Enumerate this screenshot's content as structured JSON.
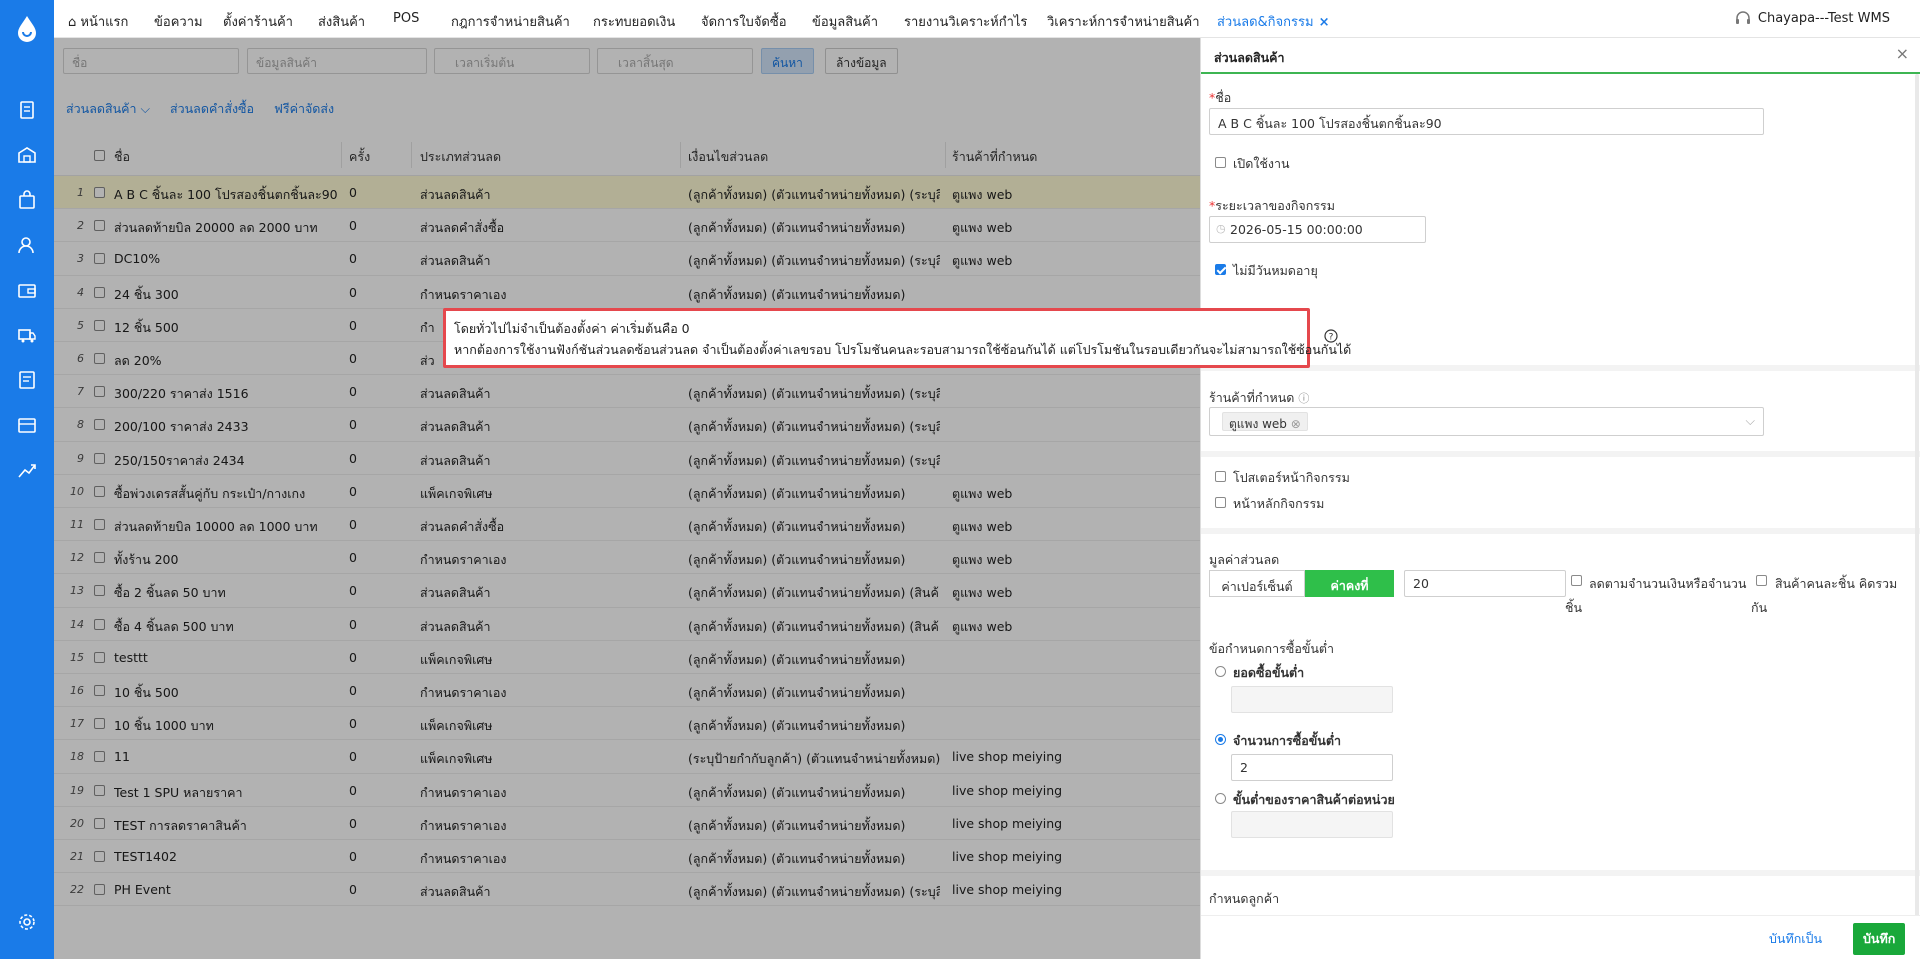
{
  "nav": {
    "home": "หน้าแรก",
    "tabs": [
      "ข้อความ",
      "ตั้งค่าร้านค้า",
      "ส่งสินค้า",
      "POS",
      "กฎการจำหน่ายสินค้า",
      "กระทบยอดเงิน",
      "จัดการใบจัดซื้อ",
      "ข้อมูลสินค้า",
      "รายงานวิเคราะห์กำไร",
      "วิเคราะห์การจำหน่ายสินค้า"
    ],
    "active_tab": "ส่วนลด&กิจกรรม",
    "close": "×",
    "user": "Chayapa---Test WMS"
  },
  "filters": {
    "name_ph": "ชื่อ",
    "product_ph": "ข้อมูลสินค้า",
    "start_ph": "เวลาเริ่มต้น",
    "end_ph": "เวลาสิ้นสุด",
    "search": "ค้นหา",
    "clear": "ล้างข้อมูล"
  },
  "subtabs": [
    "ส่วนลดสินค้า ⌵",
    "ส่วนลดคำสั่งซื้อ",
    "ฟรีค่าจัดส่ง"
  ],
  "table": {
    "headers": [
      "ชื่อ",
      "ครั้ง",
      "ประเภทส่วนลด",
      "เงื่อนไขส่วนลด",
      "ร้านค้าที่กำหนด"
    ],
    "rows": [
      [
        "1",
        "A B C ชิ้นละ 100 โปรสองชิ้นตกชิ้นละ90",
        "0",
        "ส่วนลดสินค้า",
        "(ลูกค้าทั้งหมด) (ตัวแทนจำหน่ายทั้งหมด) (ระบุสิ...",
        "ตูแพง web"
      ],
      [
        "2",
        "ส่วนลดท้ายบิล 20000 ลด 2000 บาท",
        "0",
        "ส่วนลดคำสั่งซื้อ",
        "(ลูกค้าทั้งหมด) (ตัวแทนจำหน่ายทั้งหมด)",
        "ตูแพง web"
      ],
      [
        "3",
        "DC10%",
        "0",
        "ส่วนลดสินค้า",
        "(ลูกค้าทั้งหมด) (ตัวแทนจำหน่ายทั้งหมด) (ระบุสิ...",
        "ตูแพง web"
      ],
      [
        "4",
        "24 ชิ้น 300",
        "0",
        "กำหนดราคาเอง",
        "(ลูกค้าทั้งหมด) (ตัวแทนจำหน่ายทั้งหมด)",
        ""
      ],
      [
        "5",
        "12 ชิ้น 500",
        "0",
        "กำ",
        "",
        ""
      ],
      [
        "6",
        "ลด 20%",
        "0",
        "ส่ว",
        "",
        ""
      ],
      [
        "7",
        "300/220 ราคาส่ง 1516",
        "0",
        "ส่วนลดสินค้า",
        "(ลูกค้าทั้งหมด) (ตัวแทนจำหน่ายทั้งหมด) (ระบุสิ...",
        ""
      ],
      [
        "8",
        "200/100 ราคาส่ง 2433",
        "0",
        "ส่วนลดสินค้า",
        "(ลูกค้าทั้งหมด) (ตัวแทนจำหน่ายทั้งหมด) (ระบุสิ...",
        ""
      ],
      [
        "9",
        "250/150ราคาส่ง 2434",
        "0",
        "ส่วนลดสินค้า",
        "(ลูกค้าทั้งหมด) (ตัวแทนจำหน่ายทั้งหมด) (ระบุสิ...",
        ""
      ],
      [
        "10",
        "ซื้อพ่วงเดรสสั้นคู่กับ กระเป๋า/กางเกง",
        "0",
        "แพ็คเกจพิเศษ",
        "(ลูกค้าทั้งหมด) (ตัวแทนจำหน่ายทั้งหมด)",
        "ตูแพง web"
      ],
      [
        "11",
        "ส่วนลดท้ายบิล 10000 ลด 1000 บาท",
        "0",
        "ส่วนลดคำสั่งซื้อ",
        "(ลูกค้าทั้งหมด) (ตัวแทนจำหน่ายทั้งหมด)",
        "ตูแพง web"
      ],
      [
        "12",
        "ทั้งร้าน 200",
        "0",
        "กำหนดราคาเอง",
        "(ลูกค้าทั้งหมด) (ตัวแทนจำหน่ายทั้งหมด)",
        "ตูแพง web"
      ],
      [
        "13",
        "ซื้อ 2 ชิ้นลด 50 บาท",
        "0",
        "ส่วนลดสินค้า",
        "(ลูกค้าทั้งหมด) (ตัวแทนจำหน่ายทั้งหมด) (สินค้...",
        "ตูแพง web"
      ],
      [
        "14",
        "ซื้อ 4 ชิ้นลด 500 บาท",
        "0",
        "ส่วนลดสินค้า",
        "(ลูกค้าทั้งหมด) (ตัวแทนจำหน่ายทั้งหมด) (สินค้...",
        "ตูแพง web"
      ],
      [
        "15",
        "testtt",
        "0",
        "แพ็คเกจพิเศษ",
        "(ลูกค้าทั้งหมด) (ตัวแทนจำหน่ายทั้งหมด)",
        ""
      ],
      [
        "16",
        "10 ชิ้น 500",
        "0",
        "กำหนดราคาเอง",
        "(ลูกค้าทั้งหมด) (ตัวแทนจำหน่ายทั้งหมด)",
        ""
      ],
      [
        "17",
        "10 ชิ้น 1000 บาท",
        "0",
        "แพ็คเกจพิเศษ",
        "(ลูกค้าทั้งหมด) (ตัวแทนจำหน่ายทั้งหมด)",
        ""
      ],
      [
        "18",
        "11",
        "0",
        "แพ็คเกจพิเศษ",
        "(ระบุป้ายกำกับลูกค้า) (ตัวแทนจำหน่ายทั้งหมด)",
        "live shop meiying"
      ],
      [
        "19",
        "Test 1 SPU หลายราคา",
        "0",
        "กำหนดราคาเอง",
        "(ลูกค้าทั้งหมด) (ตัวแทนจำหน่ายทั้งหมด)",
        "live shop meiying"
      ],
      [
        "20",
        "TEST การลดราคาสินค้า",
        "0",
        "กำหนดราคาเอง",
        "(ลูกค้าทั้งหมด) (ตัวแทนจำหน่ายทั้งหมด)",
        "live shop meiying"
      ],
      [
        "21",
        "TEST1402",
        "0",
        "กำหนดราคาเอง",
        "(ลูกค้าทั้งหมด) (ตัวแทนจำหน่ายทั้งหมด)",
        "live shop meiying"
      ],
      [
        "22",
        "PH Event",
        "0",
        "ส่วนลดสินค้า",
        "(ลูกค้าทั้งหมด) (ตัวแทนจำหน่ายทั้งหมด) (ระบุสิ...",
        "live shop meiying"
      ]
    ]
  },
  "tooltip": {
    "line1": "โดยทั่วไปไม่จำเป็นต้องตั้งค่า ค่าเริ่มต้นคือ 0",
    "line2": "หากต้องการใช้งานฟังก์ชันส่วนลดซ้อนส่วนลด จำเป็นต้องตั้งค่าเลขรอบ โปรโมชันคนละรอบสามารถใช้ซ้อนกันได้ แต่โปรโมชันในรอบเดียวกันจะไม่สามารถใช้ซ้อนกันได้"
  },
  "panel": {
    "title": "ส่วนลดสินค้า",
    "close": "×",
    "name_label": "ชื่อ",
    "name_value": "A B C ชิ้นละ 100 โปรสองชิ้นตกชิ้นละ90",
    "enable_label": "เปิดใช้งาน",
    "period_label": "ระยะเวลาของกิจกรรม",
    "period_value": "2026-05-15 00:00:00",
    "no_expiry_label": "ไม่มีวันหมดอายุ",
    "shop_label": "ร้านค้าที่กำหนด",
    "shop_tag": "ตูแพง web",
    "poster_label": "โปสเตอร์หน้ากิจกรรม",
    "home_label": "หน้าหลักกิจกรรม",
    "value_label": "มูลค่าส่วนลด",
    "seg_percent": "ค่าเปอร์เซ็นต์",
    "seg_fixed": "ค่าคงที่",
    "value_input": "20",
    "opt_by_amount_a": "ลดตามจำนวนเงินหรือจำนวน",
    "opt_by_amount_b": "ชิ้น",
    "opt_per_item_a": "สินค้าคนละชิ้น คิดรวม",
    "opt_per_item_b": "กัน",
    "min_label": "ข้อกำหนดการซื้อขั้นต่ำ",
    "min_amount": "ยอดซื้อขั้นต่ำ",
    "min_qty": "จำนวนการซื้อขั้นต่ำ",
    "min_qty_value": "2",
    "min_unit_price": "ขั้นต่ำของราคาสินค้าต่อหน่วย",
    "customer_label": "กำหนดลูกค้า",
    "save_draft": "บันทึกเป็น",
    "save": "บันทึก"
  },
  "colors": {
    "brand": "#1a7be8",
    "save": "#19a83a",
    "tooltip_border": "#e5484d"
  }
}
